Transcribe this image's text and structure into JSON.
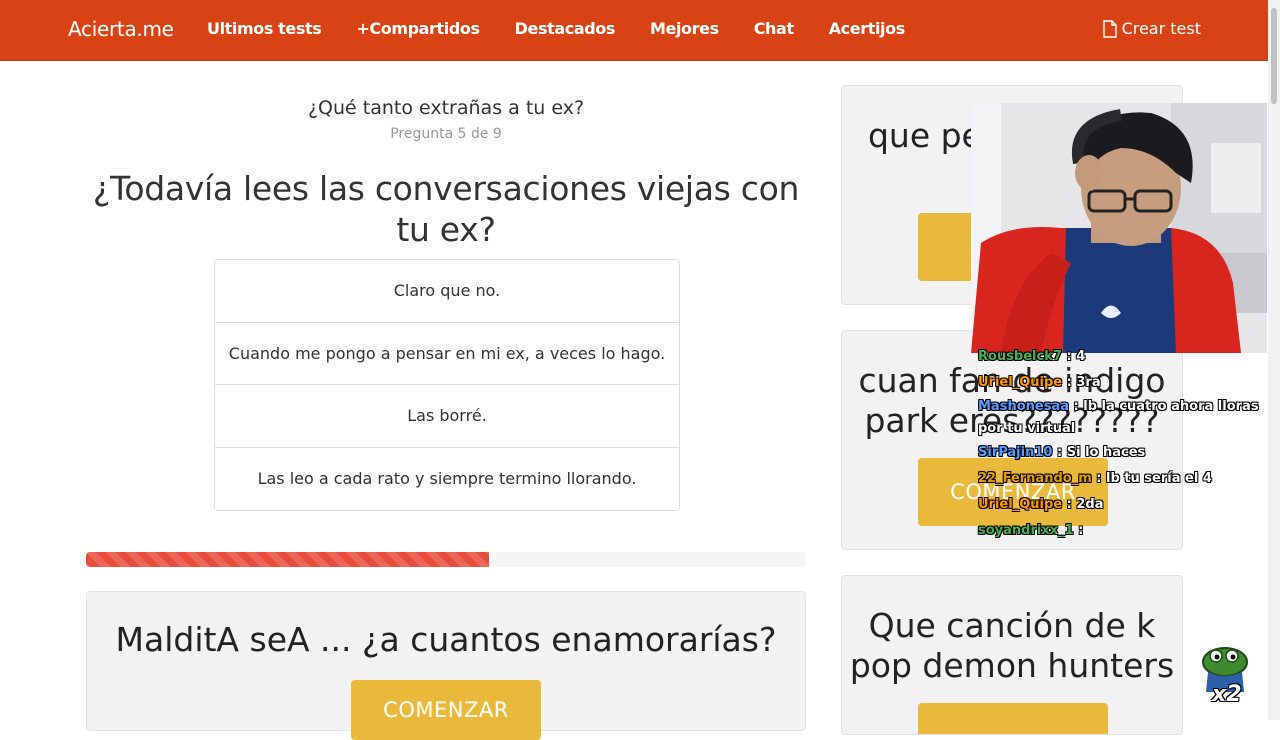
{
  "navbar": {
    "brand": "Acierta.me",
    "links": [
      "Ultimos tests",
      "+Compartidos",
      "Destacados",
      "Mejores",
      "Chat",
      "Acertijos"
    ],
    "create_label": "Crear test"
  },
  "quiz": {
    "title": "¿Qué tanto extrañas a tu ex?",
    "progress_text": "Pregunta 5 de 9",
    "progress_fraction": 0.56,
    "question": "¿Todavía lees las conversaciones viejas con tu ex?",
    "answers": [
      "Claro que no.",
      "Cuando me pongo a pensar en mi ex, a veces lo hago.",
      "Las borré.",
      "Las leo a cada rato y siempre termino llorando."
    ]
  },
  "promo_main": {
    "title": "MalditA seA ... ¿a cuantos enamorarías?",
    "button": "COMENZAR"
  },
  "sidebar": {
    "cards": [
      {
        "title": "que pe... indigo...",
        "button": "CO..."
      },
      {
        "title": "cuan fan de indigo park eres????????",
        "button": "COMENZAR"
      },
      {
        "title": "Que canción de k pop demon hunters",
        "button": ""
      }
    ]
  },
  "stream_chat": [
    {
      "user": "Rousbelck7",
      "text": "4",
      "color": "#4caf50"
    },
    {
      "user": "Uriel_Quipe",
      "text": "3ra",
      "color": "#ff9800"
    },
    {
      "user": "Mashonesaa",
      "text": "lb la cuatro ahora lloras por tu virtual",
      "color": "#5b9bff"
    },
    {
      "user": "SirPajin10",
      "text": "Si lo haces",
      "color": "#5b9bff"
    },
    {
      "user": "22_Fernando_m",
      "text": "lb tu sería el 4",
      "color": "#e0a000"
    },
    {
      "user": "Uriel_Quipe",
      "text": "2da",
      "color": "#ff9800"
    },
    {
      "user": "soyandrixx_1",
      "text": "",
      "color": "#4caf50"
    }
  ],
  "overlay": {
    "emote_badge": "x2"
  }
}
